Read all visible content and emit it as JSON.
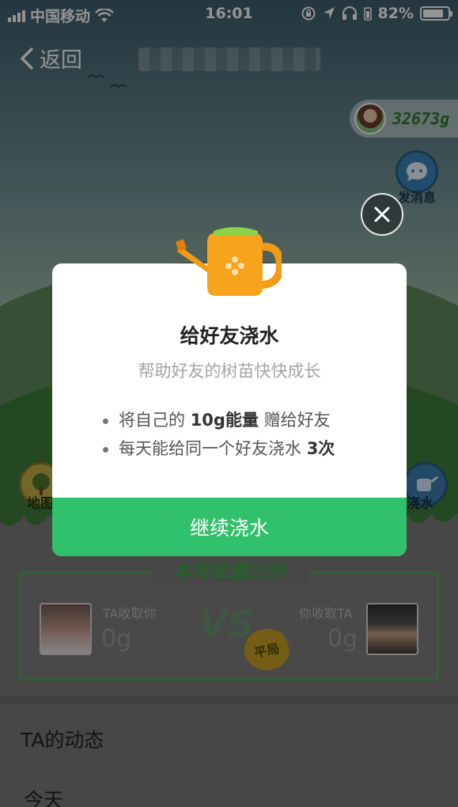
{
  "status_bar": {
    "carrier": "中国移动",
    "time": "16:01",
    "battery_percent": "82%",
    "battery_level": 0.82,
    "icons": [
      "signal-icon",
      "wifi-icon",
      "rotation-lock-icon",
      "location-icon",
      "headphones-icon",
      "battery-icon"
    ]
  },
  "nav": {
    "back_label": "返回"
  },
  "friend": {
    "energy": "32673g",
    "message_label": "发消息"
  },
  "side_buttons": {
    "left_label": "地图",
    "right_label": "浇水"
  },
  "weekly": {
    "title": "本周能量比拼",
    "left_label": "TA收取你",
    "left_value": "0g",
    "right_label": "你收取TA",
    "right_value": "0g",
    "vs": "VS",
    "result_badge": "平局"
  },
  "feed": {
    "section_title": "TA的动态",
    "today_label": "今天"
  },
  "modal": {
    "title": "给好友浇水",
    "subtitle": "帮助好友的树苗快快成长",
    "item1_prefix": "将自己的 ",
    "item1_bold": "10g能量",
    "item1_suffix": " 赠给好友",
    "item2_prefix": "每天能给同一个好友浇水 ",
    "item2_bold": "3次",
    "cta_label": "继续浇水"
  },
  "colors": {
    "accent_green": "#31c06b",
    "energy_green": "#2f7a2c",
    "watering_can_orange": "#f29b16"
  }
}
